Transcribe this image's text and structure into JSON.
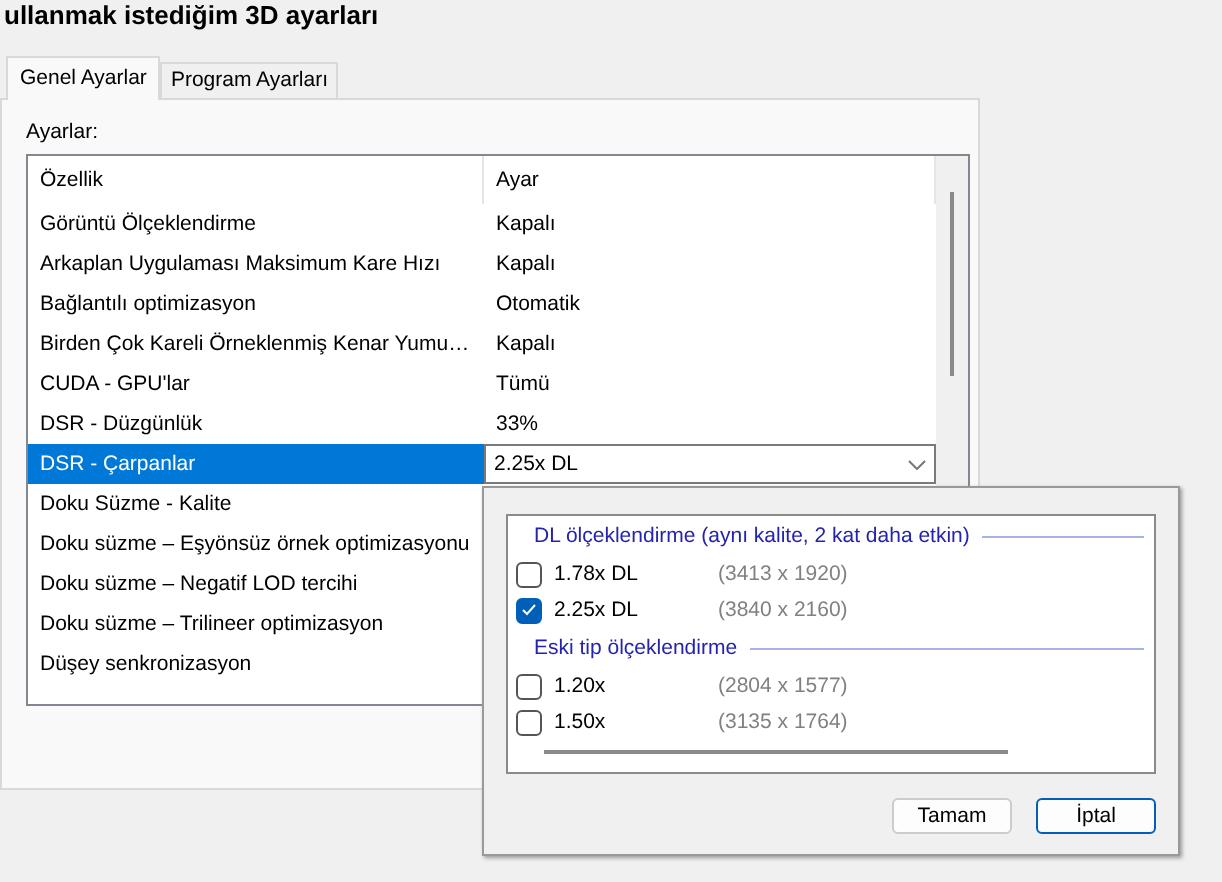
{
  "window": {
    "title": "ullanmak istediğim 3D ayarları"
  },
  "tabs": [
    {
      "label": "Genel Ayarlar",
      "selected": true
    },
    {
      "label": "Program Ayarları",
      "selected": false
    }
  ],
  "settings_label": "Ayarlar:",
  "table": {
    "columns": [
      "Özellik",
      "Ayar"
    ],
    "rows": [
      {
        "feature": "Görüntü Ölçeklendirme",
        "value": "Kapalı",
        "selected": false
      },
      {
        "feature": "Arkaplan Uygulaması Maksimum Kare Hızı",
        "value": "Kapalı",
        "selected": false
      },
      {
        "feature": "Bağlantılı optimizasyon",
        "value": "Otomatik",
        "selected": false
      },
      {
        "feature": "Birden Çok Kareli Örneklenmiş Kenar Yumu…",
        "value": "Kapalı",
        "selected": false
      },
      {
        "feature": "CUDA - GPU'lar",
        "value": "Tümü",
        "selected": false
      },
      {
        "feature": "DSR - Düzgünlük",
        "value": "33%",
        "selected": false
      },
      {
        "feature": "DSR - Çarpanlar",
        "value": "2.25x DL",
        "selected": true
      },
      {
        "feature": "Doku Süzme - Kalite",
        "value": "",
        "selected": false
      },
      {
        "feature": "Doku süzme – Eşyönsüz örnek optimizasyonu",
        "value": "",
        "selected": false
      },
      {
        "feature": "Doku süzme – Negatif LOD tercihi",
        "value": "",
        "selected": false
      },
      {
        "feature": "Doku süzme – Trilineer optimizasyon",
        "value": "",
        "selected": false
      },
      {
        "feature": "Düşey senkronizasyon",
        "value": "",
        "selected": false
      }
    ]
  },
  "dropdown": {
    "groups": [
      {
        "title": "DL ölçeklendirme (aynı kalite, 2 kat daha etkin)",
        "options": [
          {
            "label": "1.78x DL",
            "resolution": "(3413 x 1920)",
            "checked": false
          },
          {
            "label": "2.25x DL",
            "resolution": "(3840 x 2160)",
            "checked": true
          }
        ]
      },
      {
        "title": "Eski tip ölçeklendirme",
        "options": [
          {
            "label": "1.20x",
            "resolution": "(2804 x 1577)",
            "checked": false
          },
          {
            "label": "1.50x",
            "resolution": "(3135 x 1764)",
            "checked": false
          }
        ]
      }
    ],
    "buttons": [
      {
        "label": "Tamam",
        "kind": "normal"
      },
      {
        "label": "İptal",
        "kind": "default"
      }
    ]
  }
}
